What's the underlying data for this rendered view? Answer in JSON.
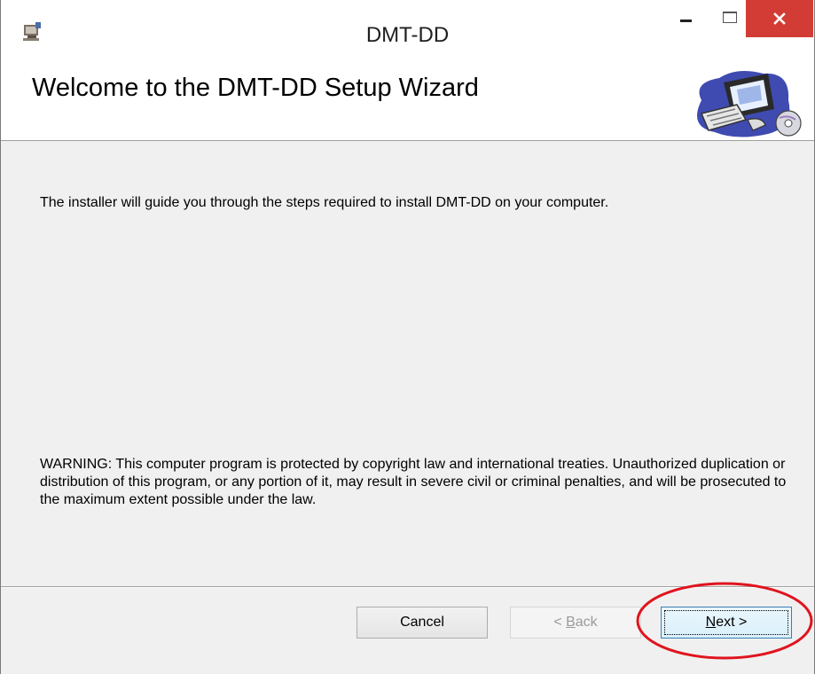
{
  "window": {
    "title": "DMT-DD",
    "app_icon": "installer-icon"
  },
  "title_buttons": {
    "minimize_icon": "minimize-icon",
    "maximize_icon": "maximize-icon",
    "close_icon": "close-icon",
    "close_color": "#d33c34"
  },
  "banner": {
    "title": "Welcome to the DMT-DD Setup Wizard",
    "image": "computer-clipart-icon"
  },
  "body": {
    "intro": "The installer will guide you through the steps required to install DMT-DD on your computer.",
    "warning": "WARNING: This computer program is protected by copyright law and international treaties. Unauthorized duplication or distribution of this program, or any portion of it, may result in severe civil or criminal penalties, and will be prosecuted to the maximum extent possible under the law."
  },
  "buttons": {
    "cancel": "Cancel",
    "back_prefix": "< ",
    "back_mnemonic": "B",
    "back_rest": "ack",
    "next_mnemonic": "N",
    "next_rest": "ext >"
  },
  "annotation": {
    "highlight_color": "#e0141e",
    "target": "next-button"
  }
}
